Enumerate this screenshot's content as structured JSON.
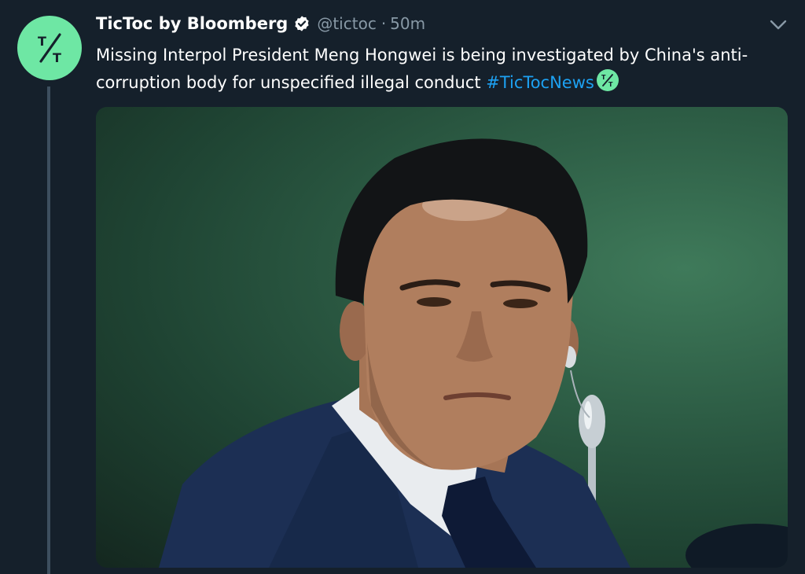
{
  "tweet": {
    "author_name": "TicToc by Bloomberg",
    "verified": true,
    "handle": "@tictoc",
    "separator": "·",
    "timestamp": "50m",
    "text_main": "Missing Interpol President Meng Hongwei is being investigated by China's anti-corruption body for unspecified illegal conduct ",
    "hashtag": "#TicTocNews",
    "avatar_icon": "tictoc-logo-icon",
    "emoji_icon": "tictoc-emoji-icon",
    "menu_icon": "chevron-down-icon"
  },
  "colors": {
    "background": "#15202b",
    "avatar": "#6ee7a4",
    "hashtag": "#1da1f2",
    "secondary_text": "#8899a6"
  }
}
